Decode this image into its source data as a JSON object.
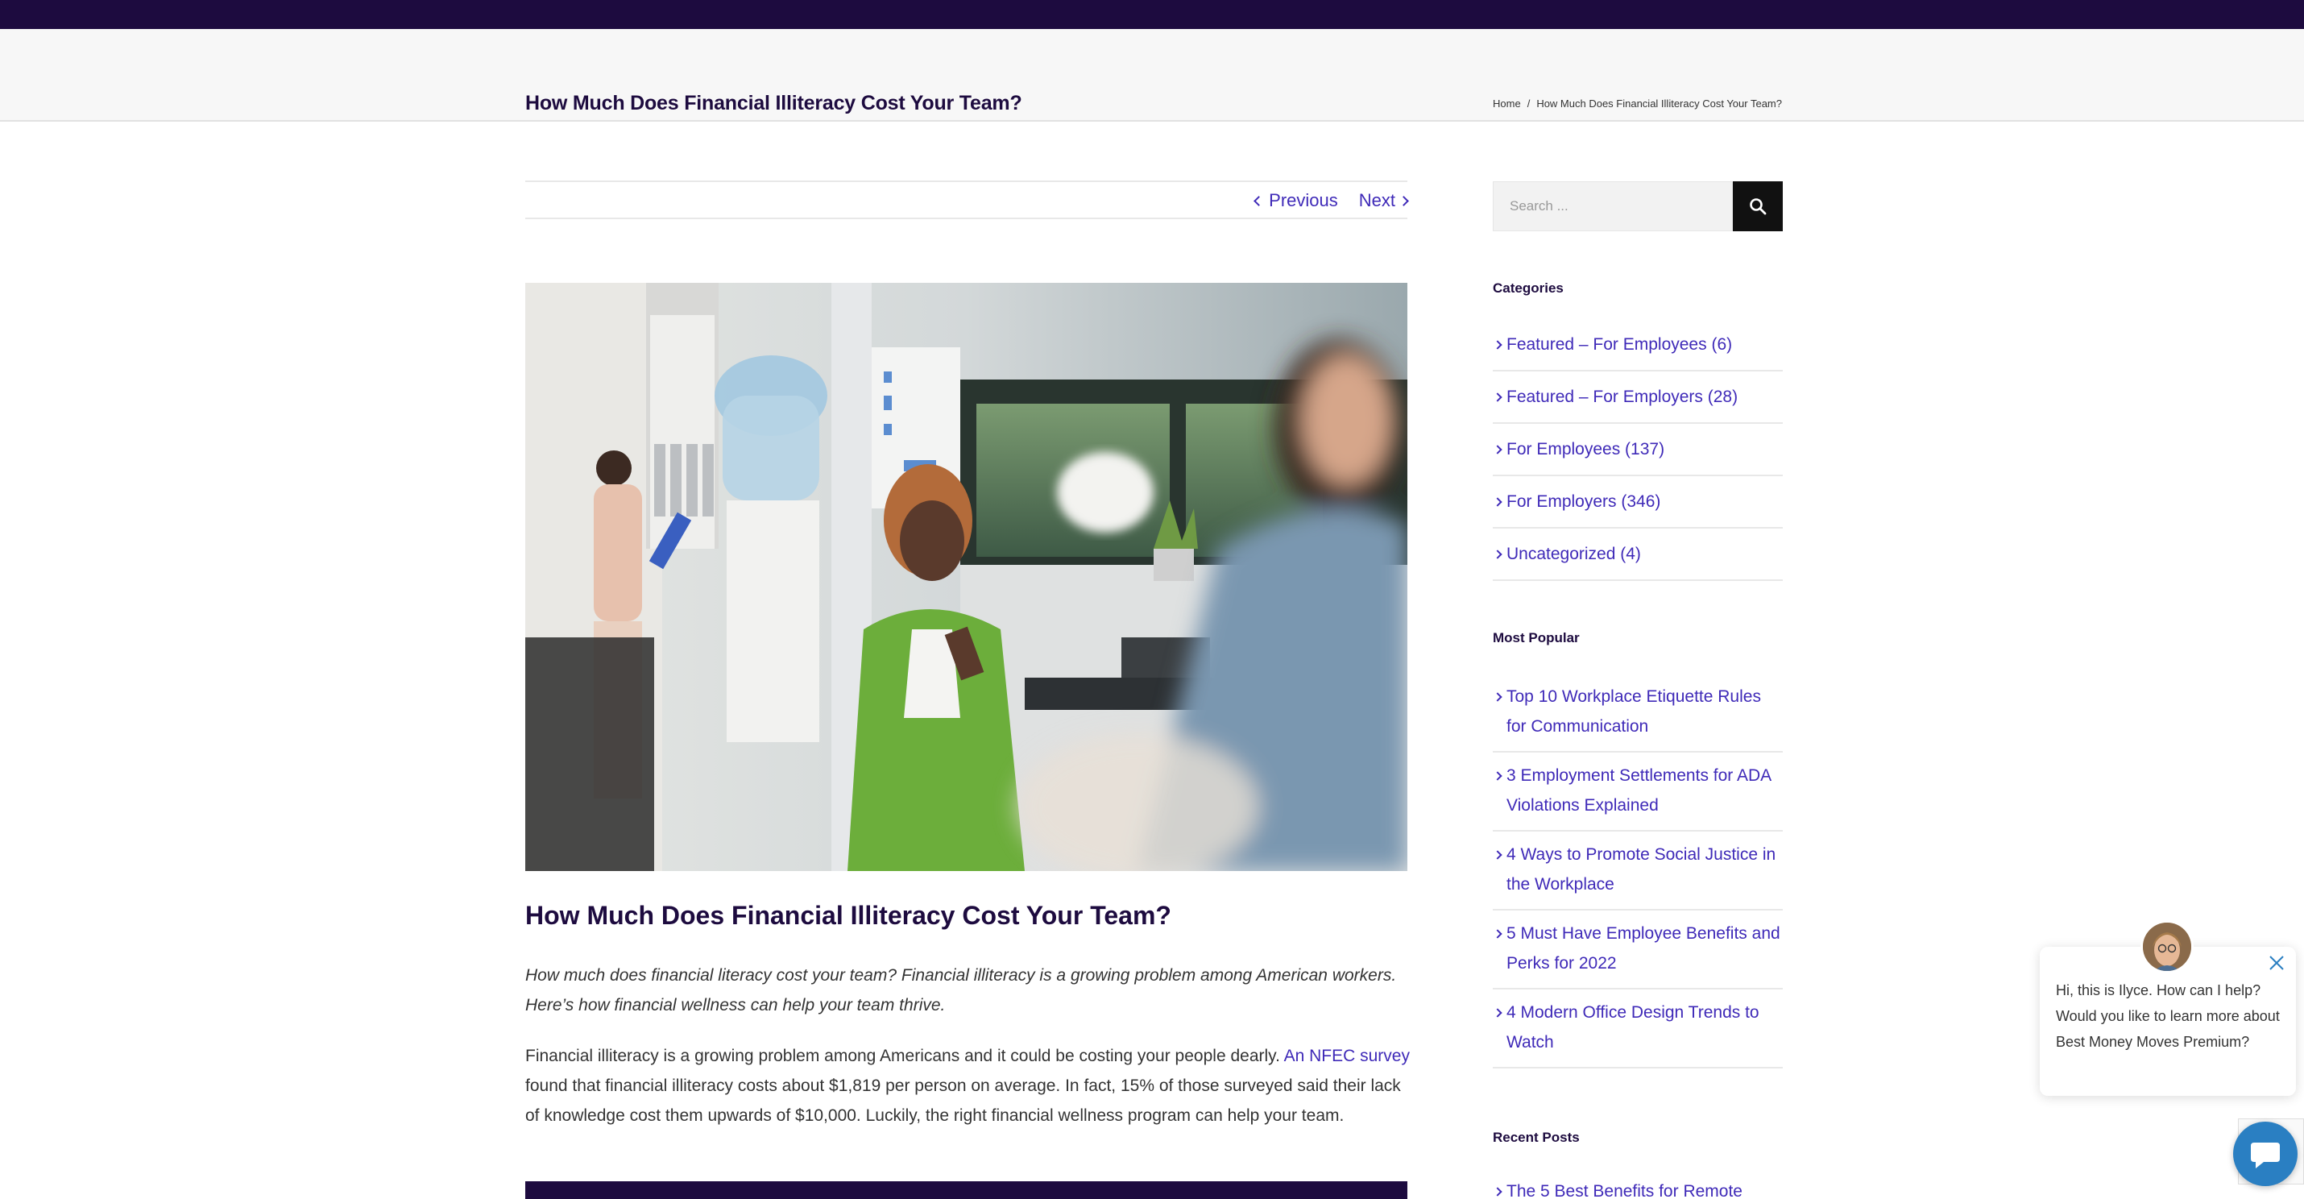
{
  "header": {
    "page_title": "How Much Does Financial Illiteracy Cost Your Team?",
    "breadcrumb": {
      "home": "Home",
      "separator": "/",
      "current": "How Much Does Financial Illiteracy Cost Your Team?"
    }
  },
  "post_nav": {
    "previous": "Previous",
    "next": "Next"
  },
  "article": {
    "title": "How Much Does Financial Illiteracy Cost Your Team?",
    "lead": "How much does financial literacy cost your team? Financial illiteracy is a growing problem among American workers. Here’s how financial wellness can help your team thrive.",
    "para1_before_link": "Financial illiteracy is a growing problem among Americans and it could be costing your people dearly. ",
    "para1_link": "An NFEC survey",
    "para1_after_link": " found that financial illiteracy costs about $1,819 per person on average. In fact, 15% of those surveyed said their lack of knowledge cost them upwards of $10,000. Luckily, the right financial wellness program can help your team."
  },
  "sidebar": {
    "search_placeholder": "Search ...",
    "categories_heading": "Categories",
    "categories": [
      {
        "label": "Featured – For Employees (6)"
      },
      {
        "label": "Featured – For Employers (28)"
      },
      {
        "label": "For Employees (137)"
      },
      {
        "label": "For Employers (346)"
      },
      {
        "label": "Uncategorized (4)"
      }
    ],
    "popular_heading": "Most Popular",
    "popular": [
      {
        "label": "Top 10 Workplace Etiquette Rules for Communication"
      },
      {
        "label": "3 Employment Settlements for ADA Violations Explained"
      },
      {
        "label": "4 Ways to Promote Social Justice in the Workplace"
      },
      {
        "label": "5 Must Have Employee Benefits and Perks for 2022"
      },
      {
        "label": "4 Modern Office Design Trends to Watch"
      }
    ],
    "recent_heading": "Recent Posts",
    "recent_first": "The 5 Best Benefits for Remote"
  },
  "chat": {
    "message": "Hi, this is Ilyce. How can I help? Would you like to learn more about Best Money Moves Premium?"
  },
  "colors": {
    "brand_dark": "#1d0b3f",
    "link": "#3f2ab8",
    "chat_blue": "#2a7fc2"
  }
}
